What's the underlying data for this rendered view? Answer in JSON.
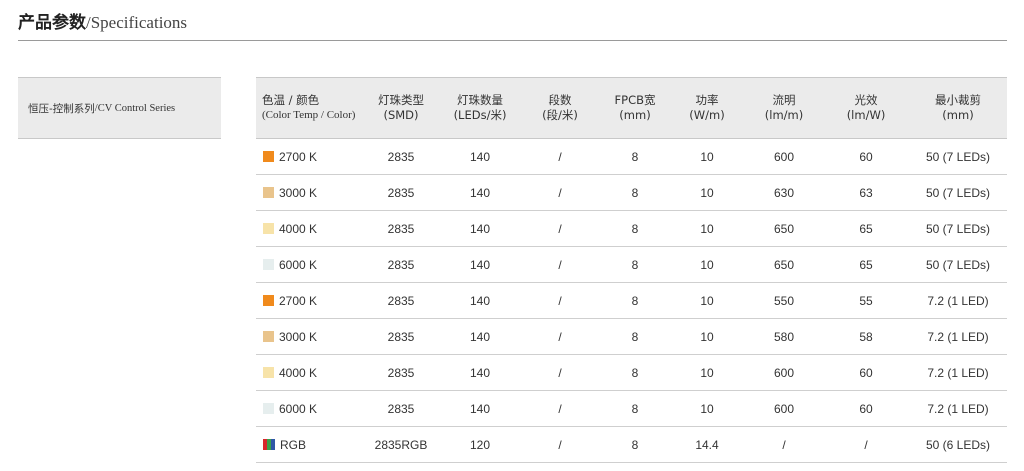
{
  "title": {
    "cn": "产品参数",
    "en": "/Specifications"
  },
  "series": {
    "cn": "恒压-控制系列",
    "en": "/CV Control Series"
  },
  "headers": {
    "color": {
      "l1": "色温 / 颜色",
      "l2": "(Color Temp / Color)"
    },
    "type": {
      "l1": "灯珠类型",
      "l2": "(SMD)"
    },
    "qty": {
      "l1": "灯珠数量",
      "l2": "(LEDs/米)"
    },
    "seg": {
      "l1": "段数",
      "l2": "(段/米)"
    },
    "fpcb": {
      "l1": "FPCB宽",
      "l2": "(mm)"
    },
    "power": {
      "l1": "功率",
      "l2": "(W/m)"
    },
    "flux": {
      "l1": "流明",
      "l2": "(lm/m)"
    },
    "eff": {
      "l1": "光效",
      "l2": "(lm/W)"
    },
    "cut": {
      "l1": "最小裁剪",
      "l2": "(mm)"
    }
  },
  "swatch_colors": {
    "2700K": "#f08a1c",
    "3000K": "#e9c48c",
    "4000K": "#f7e3a9",
    "6000K": "#e6eeee",
    "rgb_red": "#d9262c",
    "rgb_green": "#3aa14a",
    "rgb_blue": "#2f56a6"
  },
  "rows": [
    {
      "swatch": "2700K",
      "color": "2700 K",
      "type": "2835",
      "qty": "140",
      "seg": "/",
      "fpcb": "8",
      "power": "10",
      "flux": "600",
      "eff": "60",
      "cut": "50 (7 LEDs)"
    },
    {
      "swatch": "3000K",
      "color": "3000 K",
      "type": "2835",
      "qty": "140",
      "seg": "/",
      "fpcb": "8",
      "power": "10",
      "flux": "630",
      "eff": "63",
      "cut": "50 (7 LEDs)"
    },
    {
      "swatch": "4000K",
      "color": "4000 K",
      "type": "2835",
      "qty": "140",
      "seg": "/",
      "fpcb": "8",
      "power": "10",
      "flux": "650",
      "eff": "65",
      "cut": "50 (7 LEDs)"
    },
    {
      "swatch": "6000K",
      "color": "6000 K",
      "type": "2835",
      "qty": "140",
      "seg": "/",
      "fpcb": "8",
      "power": "10",
      "flux": "650",
      "eff": "65",
      "cut": "50 (7 LEDs)"
    },
    {
      "swatch": "2700K",
      "color": "2700 K",
      "type": "2835",
      "qty": "140",
      "seg": "/",
      "fpcb": "8",
      "power": "10",
      "flux": "550",
      "eff": "55",
      "cut": "7.2 (1 LED)"
    },
    {
      "swatch": "3000K",
      "color": "3000 K",
      "type": "2835",
      "qty": "140",
      "seg": "/",
      "fpcb": "8",
      "power": "10",
      "flux": "580",
      "eff": "58",
      "cut": "7.2 (1 LED)"
    },
    {
      "swatch": "4000K",
      "color": "4000 K",
      "type": "2835",
      "qty": "140",
      "seg": "/",
      "fpcb": "8",
      "power": "10",
      "flux": "600",
      "eff": "60",
      "cut": "7.2 (1 LED)"
    },
    {
      "swatch": "6000K",
      "color": "6000 K",
      "type": "2835",
      "qty": "140",
      "seg": "/",
      "fpcb": "8",
      "power": "10",
      "flux": "600",
      "eff": "60",
      "cut": "7.2 (1 LED)"
    },
    {
      "swatch": "rgb",
      "color": "RGB",
      "type": "2835RGB",
      "qty": "120",
      "seg": "/",
      "fpcb": "8",
      "power": "14.4",
      "flux": "/",
      "eff": "/",
      "cut": "50 (6 LEDs)"
    }
  ]
}
